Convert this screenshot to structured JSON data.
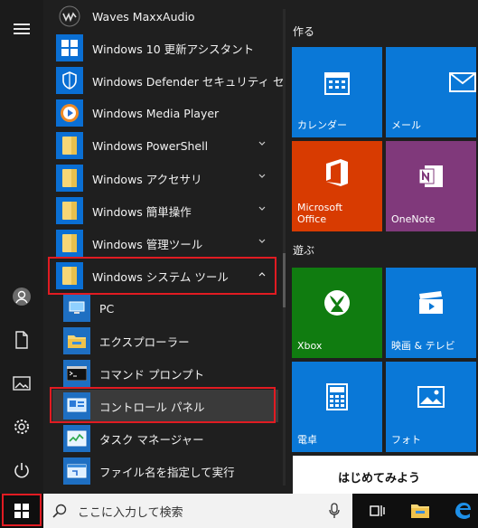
{
  "start_menu": {
    "apps": [
      {
        "label": "Waves MaxxAudio",
        "icon": "waves-logo-icon",
        "bg": "#1f1f1f"
      },
      {
        "label": "Windows 10 更新アシスタント",
        "icon": "windows-logo-icon",
        "bg": "#0a6fd4"
      },
      {
        "label": "Windows Defender セキュリティ センター",
        "icon": "shield-icon",
        "bg": "#0a6fd4"
      },
      {
        "label": "Windows Media Player",
        "icon": "media-player-icon",
        "bg": "#0a6fd4"
      },
      {
        "label": "Windows PowerShell",
        "icon": "folder-icon",
        "bg": "#0a6fd4",
        "expandable": true
      },
      {
        "label": "Windows アクセサリ",
        "icon": "folder-icon",
        "bg": "#0a6fd4",
        "expandable": true
      },
      {
        "label": "Windows 簡単操作",
        "icon": "folder-icon",
        "bg": "#0a6fd4",
        "expandable": true
      },
      {
        "label": "Windows 管理ツール",
        "icon": "folder-icon",
        "bg": "#0a6fd4",
        "expandable": true
      },
      {
        "label": "Windows システム ツール",
        "icon": "folder-icon",
        "bg": "#0a6fd4",
        "expanded": true
      }
    ],
    "sub_items": [
      {
        "label": "PC",
        "icon": "pc-icon"
      },
      {
        "label": "エクスプローラー",
        "icon": "file-explorer-icon"
      },
      {
        "label": "コマンド プロンプト",
        "icon": "command-prompt-icon"
      },
      {
        "label": "コントロール パネル",
        "icon": "control-panel-icon",
        "selected": true
      },
      {
        "label": "タスク マネージャー",
        "icon": "task-manager-icon"
      },
      {
        "label": "ファイル名を指定して実行",
        "icon": "run-icon"
      }
    ]
  },
  "tiles": {
    "group1_title": "作る",
    "group2_title": "遊ぶ",
    "calendar": "カレンダー",
    "mail": "メール",
    "office": "Microsoft\nOffice",
    "office_line1": "Microsoft",
    "office_line2": "Office",
    "onenote": "OneNote",
    "xbox": "Xbox",
    "movies": "映画 & テレビ",
    "calculator": "電卓",
    "photos": "フォト",
    "get_started": "はじめてみよう"
  },
  "taskbar": {
    "search_placeholder": "ここに入力して検索"
  },
  "colors": {
    "tile_blue": "#0a78d7",
    "office_red": "#d83b01",
    "onenote_purple": "#80397b",
    "xbox_green": "#107c10",
    "highlight_red": "#e11b22"
  }
}
